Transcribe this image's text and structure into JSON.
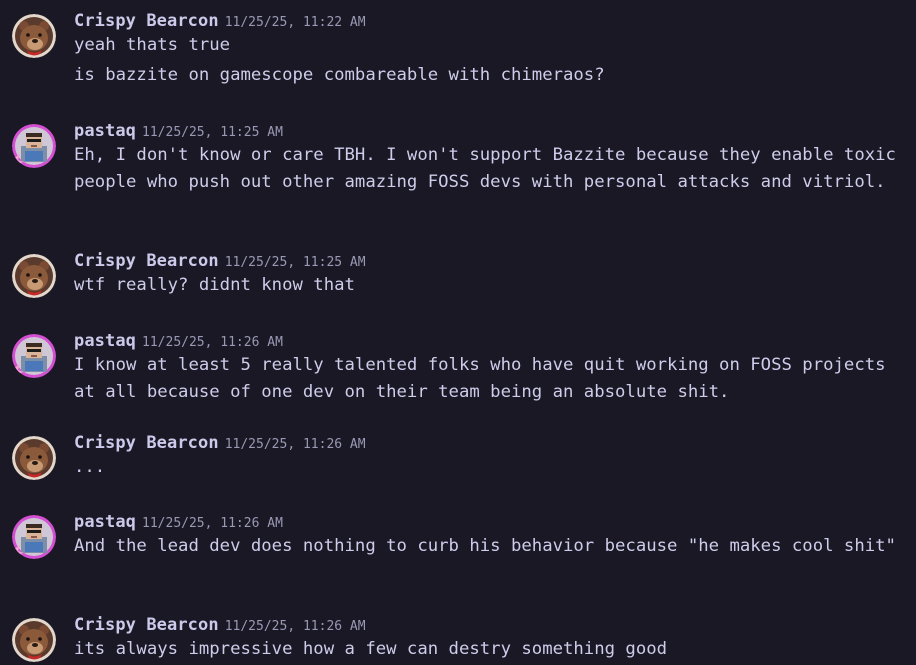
{
  "messages": [
    {
      "author": "Crispy Bearcon",
      "timestamp": "11/25/25, 11:22 AM",
      "avatar": "bear-avatar",
      "lines": [
        "yeah thats true",
        "is bazzite on gamescope combareable with chimeraos?"
      ]
    },
    {
      "author": "pastaq",
      "timestamp": "11/25/25, 11:25 AM",
      "avatar": "pixel-person-avatar",
      "lines": [
        "Eh, I don't know or care TBH. I won't support Bazzite because they enable toxic people who push out other amazing FOSS devs with personal attacks and vitriol."
      ]
    },
    {
      "author": "Crispy Bearcon",
      "timestamp": "11/25/25, 11:25 AM",
      "avatar": "bear-avatar",
      "lines": [
        "wtf really? didnt know that"
      ]
    },
    {
      "author": "pastaq",
      "timestamp": "11/25/25, 11:26 AM",
      "avatar": "pixel-person-avatar",
      "lines": [
        "I know at least 5 really talented folks who have quit working on FOSS projects at all because of one dev on their team being an absolute shit."
      ]
    },
    {
      "author": "Crispy Bearcon",
      "timestamp": "11/25/25, 11:26 AM",
      "avatar": "bear-avatar",
      "lines": [
        "..."
      ]
    },
    {
      "author": "pastaq",
      "timestamp": "11/25/25, 11:26 AM",
      "avatar": "pixel-person-avatar",
      "lines": [
        "And the lead dev does nothing to curb his behavior because \"he makes cool shit\""
      ]
    },
    {
      "author": "Crispy Bearcon",
      "timestamp": "11/25/25, 11:26 AM",
      "avatar": "bear-avatar",
      "lines": [
        "its always impressive how a few can destry something good"
      ]
    }
  ],
  "colors": {
    "background": "#191824",
    "text": "#ceccea",
    "timestamp": "#9a98b4",
    "avatar_ring_bear": "#e2d8cc",
    "avatar_ring_pastaq": "#d44fd1"
  }
}
